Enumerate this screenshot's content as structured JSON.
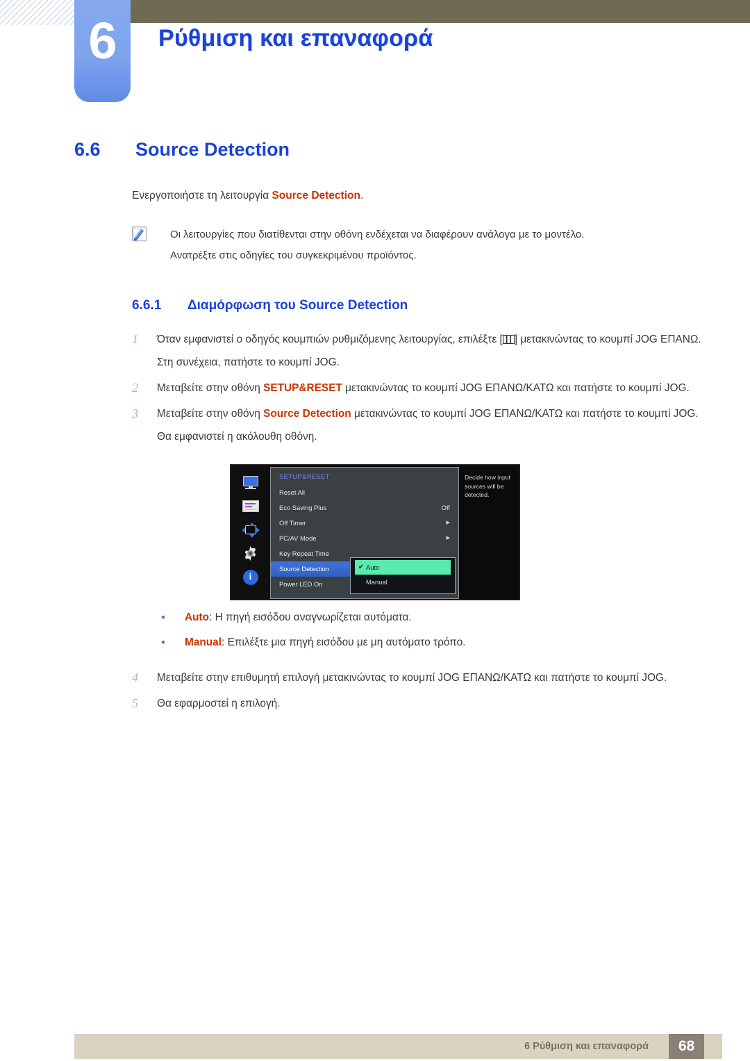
{
  "chapter": {
    "number": "6",
    "title": "Ρύθμιση και επαναφορά"
  },
  "section": {
    "number": "6.6",
    "title": "Source Detection",
    "intro_prefix": "Ενεργοποιήστε τη λειτουργία ",
    "intro_keyword": "Source Detection",
    "intro_suffix": "."
  },
  "note": {
    "icon": "pencil-note-icon",
    "line1": "Οι λειτουργίες που διατίθενται στην οθόνη ενδέχεται να διαφέρουν ανάλογα με το μοντέλο.",
    "line2": "Ανατρέξτε στις οδηγίες του συγκεκριμένου προϊόντος."
  },
  "subsection": {
    "number": "6.6.1",
    "title_prefix": "Διαμόρφωση του ",
    "title_keyword": "Source Detection"
  },
  "steps": [
    {
      "num": "1",
      "text_a": "Όταν εμφανιστεί ο οδηγός κουμπιών ρυθμιζόμενης λειτουργίας, επιλέξτε [",
      "text_b": "] μετακινώντας το κουμπί JOG ΕΠΑΝΩ.",
      "sub": "Στη συνέχεια, πατήστε το κουμπί JOG."
    },
    {
      "num": "2",
      "text_a": "Μεταβείτε στην οθόνη ",
      "keyword": "SETUP&RESET",
      "text_b": " μετακινώντας το κουμπί JOG ΕΠΑΝΩ/ΚΑΤΩ και πατήστε το κουμπί JOG.",
      "sub": ""
    },
    {
      "num": "3",
      "text_a": "Μεταβείτε στην οθόνη ",
      "keyword": "Source Detection",
      "text_b": " μετακινώντας το κουμπί JOG ΕΠΑΝΩ/ΚΑΤΩ και πατήστε το κουμπί JOG.",
      "sub": "Θα εμφανιστεί η ακόλουθη οθόνη."
    },
    {
      "num": "4",
      "text_a": "Μεταβείτε στην επιθυμητή επιλογή μετακινώντας το κουμπί JOG ΕΠΑΝΩ/ΚΑΤΩ και πατήστε το κουμπί JOG.",
      "keyword": "",
      "text_b": "",
      "sub": ""
    },
    {
      "num": "5",
      "text_a": "Θα εφαρμοστεί η επιλογή.",
      "keyword": "",
      "text_b": "",
      "sub": ""
    }
  ],
  "osd": {
    "title": "SETUP&RESET",
    "icons": [
      "monitor-icon",
      "picture-icon",
      "osd-position-icon",
      "gear-icon",
      "info-icon"
    ],
    "rows": [
      {
        "label": "Reset All",
        "value": "",
        "arrow": false,
        "selected": false
      },
      {
        "label": "Eco Saving Plus",
        "value": "Off",
        "arrow": false,
        "selected": false
      },
      {
        "label": "Off Timer",
        "value": "",
        "arrow": true,
        "selected": false
      },
      {
        "label": "PC/AV Mode",
        "value": "",
        "arrow": true,
        "selected": false
      },
      {
        "label": "Key Repeat Time",
        "value": "",
        "arrow": false,
        "selected": false
      },
      {
        "label": "Source Detection",
        "value": "",
        "arrow": false,
        "selected": true
      },
      {
        "label": "Power LED On",
        "value": "",
        "arrow": false,
        "selected": false
      }
    ],
    "submenu": [
      {
        "label": "Auto",
        "checked": true
      },
      {
        "label": "Manual",
        "checked": false
      }
    ],
    "help_text": "Decide how input sources will be detected.",
    "colors": {
      "highlight_row": "#3f74d6",
      "highlight_option": "#59eaae",
      "title": "#6f86e8"
    }
  },
  "bullets": [
    {
      "marker": "•",
      "keyword": "Auto",
      "text": ": Η πηγή εισόδου αναγνωρίζεται αυτόματα."
    },
    {
      "marker": "•",
      "keyword": "Manual",
      "text": ": Επιλέξτε μια πηγή εισόδου με μη αυτόματο τρόπο."
    }
  ],
  "footer": {
    "text": "6 Ρύθμιση και επαναφορά",
    "page": "68"
  }
}
